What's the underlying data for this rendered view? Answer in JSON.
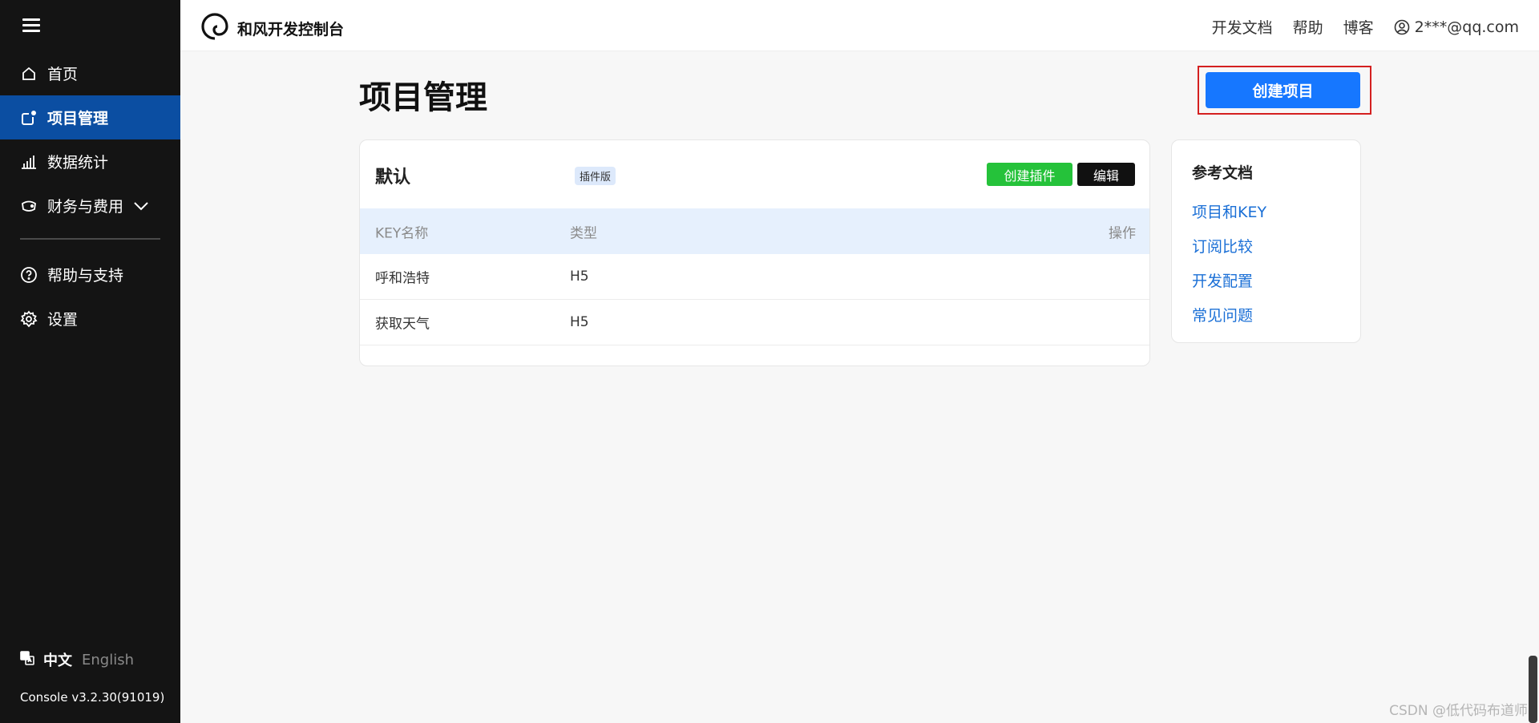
{
  "sidebar": {
    "items": [
      {
        "label": "首页",
        "icon": "home-icon"
      },
      {
        "label": "项目管理",
        "icon": "project-icon",
        "active": true
      },
      {
        "label": "数据统计",
        "icon": "bar-chart-icon"
      },
      {
        "label": "财务与费用",
        "icon": "wallet-icon"
      },
      {
        "label": "帮助与支持",
        "icon": "question-icon"
      },
      {
        "label": "设置",
        "icon": "gear-icon"
      }
    ],
    "lang_zh": "中文",
    "lang_en": "English",
    "version": "Console v3.2.30(91019)"
  },
  "topbar": {
    "brand": "和风开发控制台",
    "links": [
      "开发文档",
      "帮助",
      "博客"
    ],
    "user": "2***@qq.com"
  },
  "main": {
    "title": "项目管理",
    "create_label": "创建项目",
    "card": {
      "title": "默认",
      "badge": "插件版",
      "plugin_label": "创建插件",
      "edit_label": "编辑",
      "columns": [
        "KEY名称",
        "类型",
        "操作"
      ],
      "rows": [
        {
          "name": "呼和浩特",
          "type": "H5"
        },
        {
          "name": "获取天气",
          "type": "H5"
        }
      ]
    },
    "docs": {
      "title": "参考文档",
      "links": [
        "项目和KEY",
        "订阅比较",
        "开发配置",
        "常见问题"
      ]
    }
  },
  "watermark": "CSDN @低代码布道师",
  "colors": {
    "sidebar_bg": "#141414",
    "active_bg": "#0b4ea2",
    "primary": "#1677ff",
    "green": "#25c23a",
    "link": "#1a6fd6",
    "highlight": "#d42020"
  }
}
